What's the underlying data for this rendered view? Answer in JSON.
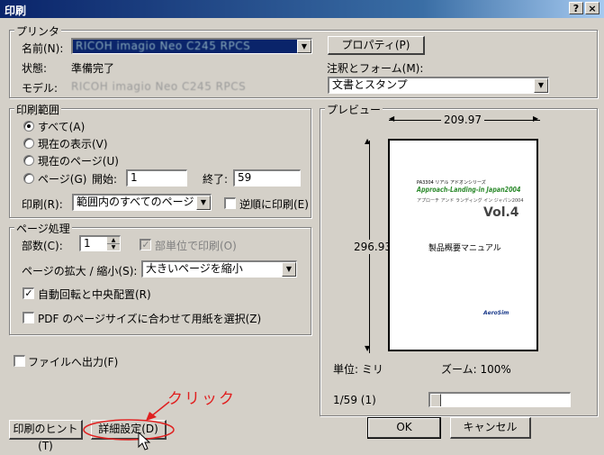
{
  "window": {
    "title": "印刷",
    "help_label": "?",
    "close_label": "×"
  },
  "printer": {
    "group_label": "プリンタ",
    "name_label": "名前(N):",
    "name_value": "RICOH imagio Neo C245 RPCS",
    "properties_button": "プロパティ(P)",
    "status_label": "状態:",
    "status_value": "準備完了",
    "model_label": "モデル:",
    "model_value": "RICOH imagio Neo C245 RPCS",
    "annotations_label": "注釈とフォーム(M):",
    "annotations_value": "文書とスタンプ"
  },
  "range": {
    "group_label": "印刷範囲",
    "all": "すべて(A)",
    "current_view": "現在の表示(V)",
    "current_page": "現在のページ(U)",
    "pages": "ページ(G)",
    "start_label": "開始:",
    "start_value": "1",
    "end_label": "終了:",
    "end_value": "59",
    "print_label": "印刷(R):",
    "print_value": "範囲内のすべてのページ",
    "reverse_label": "逆順に印刷(E)"
  },
  "handling": {
    "group_label": "ページ処理",
    "copies_label": "部数(C):",
    "copies_value": "1",
    "collate_label": "部単位で印刷(O)",
    "scaling_label": "ページの拡大 / 縮小(S):",
    "scaling_value": "大きいページを縮小",
    "autorotate_label": "自動回転と中央配置(R)",
    "pdf_size_label": "PDF のページサイズに合わせて用紙を選択(Z)"
  },
  "print_to_file": "ファイルへ出力(F)",
  "preview": {
    "group_label": "プレビュー",
    "width_value": "209.97",
    "height_value": "296.93",
    "units": "単位: ミリ",
    "zoom": "ズーム: 100%",
    "page_indicator": "1/59 (1)",
    "page_header": "PA3304 リアル アドオンシリーズ",
    "page_logo": "Approach-Landing-in Japan2004",
    "page_subtitle": "アプローチ アンド ランディング イン ジャパン2004",
    "page_vol": "Vol.4",
    "page_title": "製品概要マニュアル",
    "page_brand": "AeroSim",
    "colors": {
      "logo": "#2e8b2e",
      "vol": "#444444",
      "brand": "#1a3a8a"
    }
  },
  "buttons": {
    "tips": "印刷のヒント(T)",
    "advanced": "詳細設定(D)",
    "ok": "OK",
    "cancel": "キャンセル"
  },
  "annotation": {
    "click_label": "クリック",
    "color": "#e02020"
  }
}
